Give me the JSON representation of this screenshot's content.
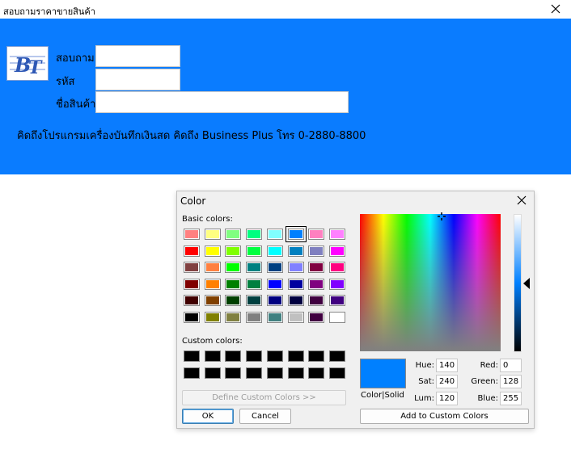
{
  "main": {
    "title": "สอบถามราคาขายสินค้า",
    "labels": {
      "query": "สอบถาม",
      "code": "รหัส",
      "product_name": "ชื่อสินค้า"
    },
    "fields": {
      "query": "",
      "code": "",
      "product_name": ""
    },
    "logo_text": "BT",
    "promo": "คิดถึงโปรแกรมเครื่องบันทึกเงินสด คิดถึง Business Plus โทร 0-2880-8800",
    "background": "#0a7cff"
  },
  "dialog": {
    "title": "Color",
    "basic_label": "Basic colors:",
    "custom_label": "Custom colors:",
    "basic_colors": [
      [
        "#ff8080",
        "#ffff80",
        "#80ff80",
        "#00ff80",
        "#80ffff",
        "#0080ff",
        "#ff80c0",
        "#ff80ff"
      ],
      [
        "#ff0000",
        "#ffff00",
        "#80ff00",
        "#00ff40",
        "#00ffff",
        "#0080c0",
        "#8080c0",
        "#ff00ff"
      ],
      [
        "#804040",
        "#ff8040",
        "#00ff00",
        "#008080",
        "#004080",
        "#8080ff",
        "#800040",
        "#ff0080"
      ],
      [
        "#800000",
        "#ff8000",
        "#008000",
        "#008040",
        "#0000ff",
        "#0000a0",
        "#800080",
        "#8000ff"
      ],
      [
        "#400000",
        "#804000",
        "#004000",
        "#004040",
        "#000080",
        "#000040",
        "#400040",
        "#400080"
      ],
      [
        "#000000",
        "#808000",
        "#808040",
        "#808080",
        "#408080",
        "#c0c0c0",
        "#400040",
        "#ffffff"
      ]
    ],
    "selected_basic": "0-5",
    "custom_colors": [
      [
        "#000000",
        "#000000",
        "#000000",
        "#000000",
        "#000000",
        "#000000",
        "#000000",
        "#000000"
      ],
      [
        "#000000",
        "#000000",
        "#000000",
        "#000000",
        "#000000",
        "#000000",
        "#000000",
        "#000000"
      ]
    ],
    "define_custom": "Define Custom Colors >>",
    "ok": "OK",
    "cancel": "Cancel",
    "add_custom": "Add to Custom Colors",
    "preview_label": "Color|Solid",
    "preview_color": "#0080ff",
    "values": {
      "hue_label": "Hue:",
      "hue": "140",
      "sat_label": "Sat:",
      "sat": "240",
      "lum_label": "Lum:",
      "lum": "120",
      "red_label": "Red:",
      "red": "0",
      "green_label": "Green:",
      "green": "128",
      "blue_label": "Blue:",
      "blue": "255"
    }
  }
}
